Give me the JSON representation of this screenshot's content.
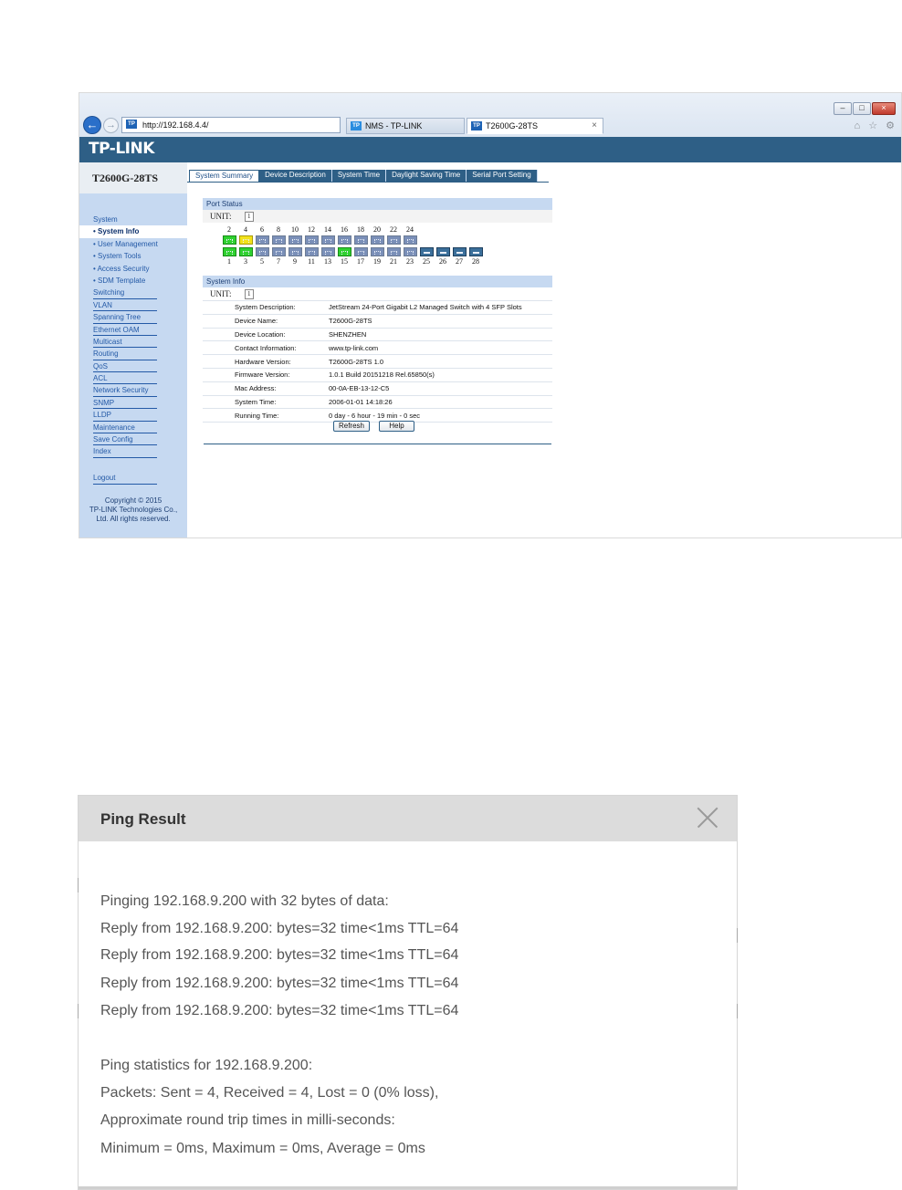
{
  "browser": {
    "url": "http://192.168.4.4/",
    "address_tools": "⌕ ▾ ↻",
    "tabs": [
      {
        "label": "NMS - TP-LINK",
        "icon": "tplink-favicon-icon"
      },
      {
        "label": "T2600G-28TS",
        "icon": "tplink-favicon-icon",
        "active": true
      }
    ],
    "tab_close": "×",
    "favicon_text": "TP",
    "window_controls": [
      "–",
      "□",
      "×"
    ],
    "toolbar_icons": "⌂ ☆ ⚙"
  },
  "app": {
    "brand": "TP-LINK",
    "model": "T2600G-28TS",
    "menu": [
      {
        "label": "System",
        "type": "group"
      },
      {
        "label": "• System Info",
        "type": "sub",
        "active": true
      },
      {
        "label": "• User Management",
        "type": "sub"
      },
      {
        "label": "• System Tools",
        "type": "sub"
      },
      {
        "label": "• Access Security",
        "type": "sub"
      },
      {
        "label": "• SDM Template",
        "type": "sub"
      },
      {
        "label": "Switching",
        "type": "item"
      },
      {
        "label": "VLAN",
        "type": "item"
      },
      {
        "label": "Spanning Tree",
        "type": "item"
      },
      {
        "label": "Ethernet OAM",
        "type": "item"
      },
      {
        "label": "Multicast",
        "type": "item"
      },
      {
        "label": "Routing",
        "type": "item"
      },
      {
        "label": "QoS",
        "type": "item"
      },
      {
        "label": "ACL",
        "type": "item"
      },
      {
        "label": "Network Security",
        "type": "item"
      },
      {
        "label": "SNMP",
        "type": "item"
      },
      {
        "label": "LLDP",
        "type": "item"
      },
      {
        "label": "Maintenance",
        "type": "item"
      },
      {
        "label": "Save Config",
        "type": "item"
      },
      {
        "label": "Index",
        "type": "item"
      }
    ],
    "logout": "Logout",
    "copyright": [
      "Copyright © 2015",
      "TP-LINK Technologies Co.,",
      "Ltd. All rights reserved."
    ],
    "tabs": [
      "System Summary",
      "Device Description",
      "System Time",
      "Daylight Saving Time",
      "Serial Port Setting"
    ],
    "port_status": {
      "title": "Port Status",
      "unit_label": "UNIT:",
      "unit_value": "1",
      "top_numbers": [
        "2",
        "4",
        "6",
        "8",
        "10",
        "12",
        "14",
        "16",
        "18",
        "20",
        "22",
        "24"
      ],
      "bottom_numbers": [
        "1",
        "3",
        "5",
        "7",
        "9",
        "11",
        "13",
        "15",
        "17",
        "19",
        "21",
        "23",
        "25",
        "26",
        "27",
        "28"
      ],
      "port_states_top": [
        "up",
        "ylw",
        "down",
        "down",
        "down",
        "down",
        "down",
        "down",
        "down",
        "down",
        "down",
        "down"
      ],
      "port_states_bottom": [
        "up",
        "up",
        "down",
        "down",
        "down",
        "down",
        "down",
        "up",
        "down",
        "down",
        "down",
        "down",
        "sfp",
        "sfp",
        "sfp",
        "sfp"
      ]
    },
    "system_info": {
      "title": "System Info",
      "unit_label": "UNIT:",
      "unit_value": "1",
      "rows": [
        {
          "label": "System Description:",
          "value": "JetStream 24-Port Gigabit L2 Managed Switch with 4 SFP Slots"
        },
        {
          "label": "Device Name:",
          "value": "T2600G-28TS"
        },
        {
          "label": "Device Location:",
          "value": "SHENZHEN"
        },
        {
          "label": "Contact Information:",
          "value": "www.tp-link.com"
        },
        {
          "label": "Hardware Version:",
          "value": "T2600G-28TS 1.0"
        },
        {
          "label": "Firmware Version:",
          "value": "1.0.1 Build 20151218 Rel.65850(s)"
        },
        {
          "label": "Mac Address:",
          "value": "00-0A-EB-13-12-C5"
        },
        {
          "label": "System Time:",
          "value": "2006-01-01 14:18:26"
        },
        {
          "label": "Running Time:",
          "value": "0 day - 6 hour - 19 min - 0 sec"
        }
      ],
      "refresh_label": "Refresh",
      "help_label": "Help"
    }
  },
  "ping": {
    "title": "Ping Result",
    "lines": [
      "Pinging 192.168.9.200 with 32 bytes of data:",
      "Reply from 192.168.9.200: bytes=32 time<1ms TTL=64",
      "Reply from 192.168.9.200: bytes=32 time<1ms TTL=64",
      "Reply from 192.168.9.200: bytes=32 time<1ms TTL=64",
      "Reply from 192.168.9.200: bytes=32 time<1ms TTL=64",
      "",
      "Ping statistics for 192.168.9.200:",
      "Packets: Sent = 4, Received = 4, Lost = 0 (0% loss),",
      "Approximate round trip times in milli-seconds:",
      "Minimum = 0ms, Maximum = 0ms, Average = 0ms"
    ]
  }
}
